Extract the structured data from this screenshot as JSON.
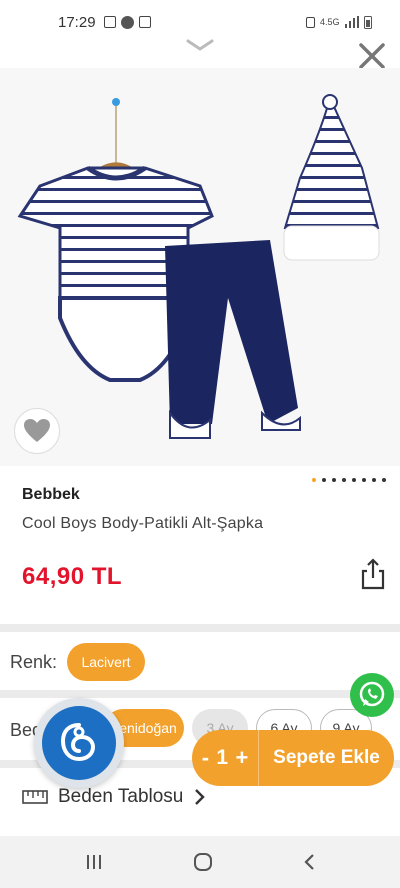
{
  "status_bar": {
    "time": "17:29",
    "network": "4.5G"
  },
  "product": {
    "brand": "Bebbek",
    "name": "Cool Boys Body-Patikli Alt-Şapka",
    "price": "64,90 TL",
    "image_count": 8,
    "current_image": 1
  },
  "color": {
    "label": "Renk:",
    "selected": "Lacivert"
  },
  "size": {
    "label": "Beden:",
    "options": [
      {
        "label": "Yenidoğan",
        "state": "selected"
      },
      {
        "label": "3 Ay",
        "state": "disabled"
      },
      {
        "label": "6 Ay",
        "state": "available"
      },
      {
        "label": "9 Ay",
        "state": "available"
      }
    ]
  },
  "size_table": {
    "label": "Beden Tablosu"
  },
  "cart": {
    "minus": "-",
    "quantity": "1",
    "plus": "+",
    "add_label": "Sepete Ekle"
  },
  "colors": {
    "accent": "#f3a12d",
    "price": "#e3132c",
    "navy": "#1b2560",
    "whatsapp": "#2fbf4a",
    "chat": "#1d6fc3"
  },
  "icons": {
    "close": "close-icon",
    "favorite": "heart-icon",
    "share": "share-icon",
    "ruler": "ruler-icon",
    "whatsapp": "whatsapp-icon",
    "chat": "chat-assistant-icon"
  }
}
